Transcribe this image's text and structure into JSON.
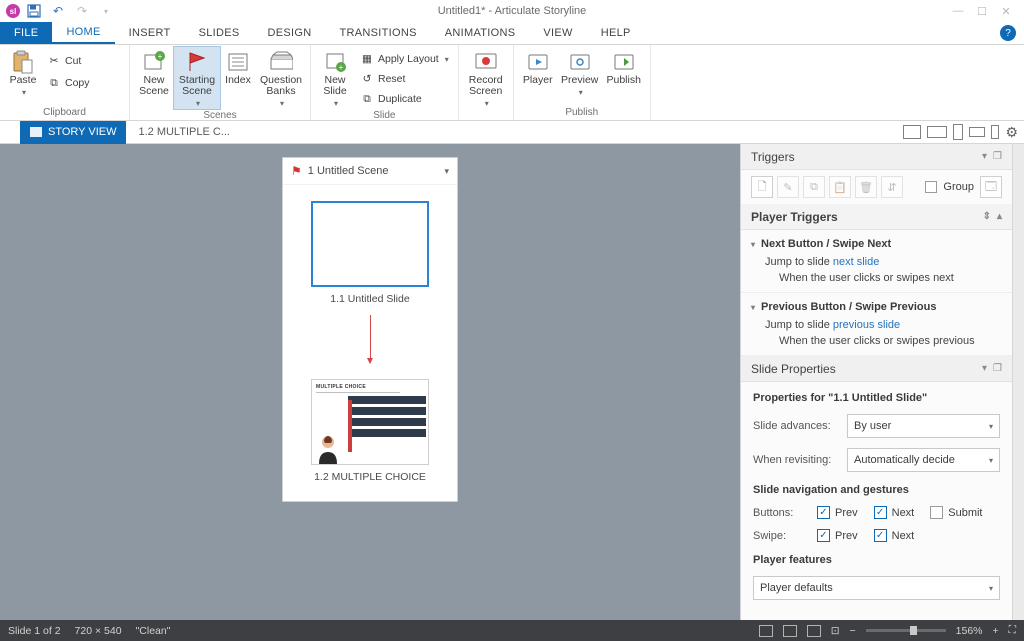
{
  "title": "Untitled1* - Articulate Storyline",
  "qat": {
    "sl": "sl"
  },
  "tabs": {
    "file": "FILE",
    "home": "HOME",
    "insert": "INSERT",
    "slides": "SLIDES",
    "design": "DESIGN",
    "transitions": "TRANSITIONS",
    "animations": "ANIMATIONS",
    "view": "VIEW",
    "help": "HELP"
  },
  "ribbon": {
    "clipboard": {
      "paste": "Paste",
      "cut": "Cut",
      "copy": "Copy",
      "label": "Clipboard"
    },
    "scenes": {
      "new_scene": "New\nScene",
      "starting_scene": "Starting\nScene",
      "index": "Index",
      "question_banks": "Question\nBanks",
      "label": "Scenes"
    },
    "slide": {
      "new_slide": "New\nSlide",
      "apply_layout": "Apply Layout",
      "reset": "Reset",
      "duplicate": "Duplicate",
      "label": "Slide"
    },
    "record": {
      "record_screen": "Record\nScreen"
    },
    "publish": {
      "player": "Player",
      "preview": "Preview",
      "publish": "Publish",
      "label": "Publish"
    }
  },
  "viewbar": {
    "story": "STORY VIEW",
    "slide": "1.2 MULTIPLE C..."
  },
  "scene": {
    "title": "1 Untitled Scene",
    "slide1": "1.1 Untitled Slide",
    "slide2_inner": "MULTIPLE CHOICE",
    "slide2": "1.2 MULTIPLE CHOICE"
  },
  "triggers": {
    "title": "Triggers",
    "group": "Group",
    "pt_title": "Player Triggers",
    "next_h": "Next Button / Swipe Next",
    "next_l1a": "Jump to slide ",
    "next_l1b": "next slide",
    "next_l2a": "When the ",
    "next_l2b": "user clicks or swipes",
    "next_l2c": " ",
    "next_l2d": "next",
    "prev_h": "Previous Button / Swipe Previous",
    "prev_l1a": "Jump to slide ",
    "prev_l1b": "previous slide",
    "prev_l2a": "When the ",
    "prev_l2b": "user clicks or swipes",
    "prev_l2c": " ",
    "prev_l2d": "previous"
  },
  "props": {
    "title": "Slide Properties",
    "for": "Properties for \"1.1 Untitled Slide\"",
    "adv_l": "Slide advances:",
    "adv_v": "By user",
    "rev_l": "When revisiting:",
    "rev_v": "Automatically decide",
    "nav_h": "Slide navigation and gestures",
    "buttons": "Buttons:",
    "swipe": "Swipe:",
    "prev": "Prev",
    "next": "Next",
    "submit": "Submit",
    "pf_h": "Player features",
    "pf_v": "Player defaults"
  },
  "status": {
    "slide": "Slide 1 of 2",
    "dim": "720 × 540",
    "clean": "\"Clean\"",
    "zoom": "156%"
  }
}
